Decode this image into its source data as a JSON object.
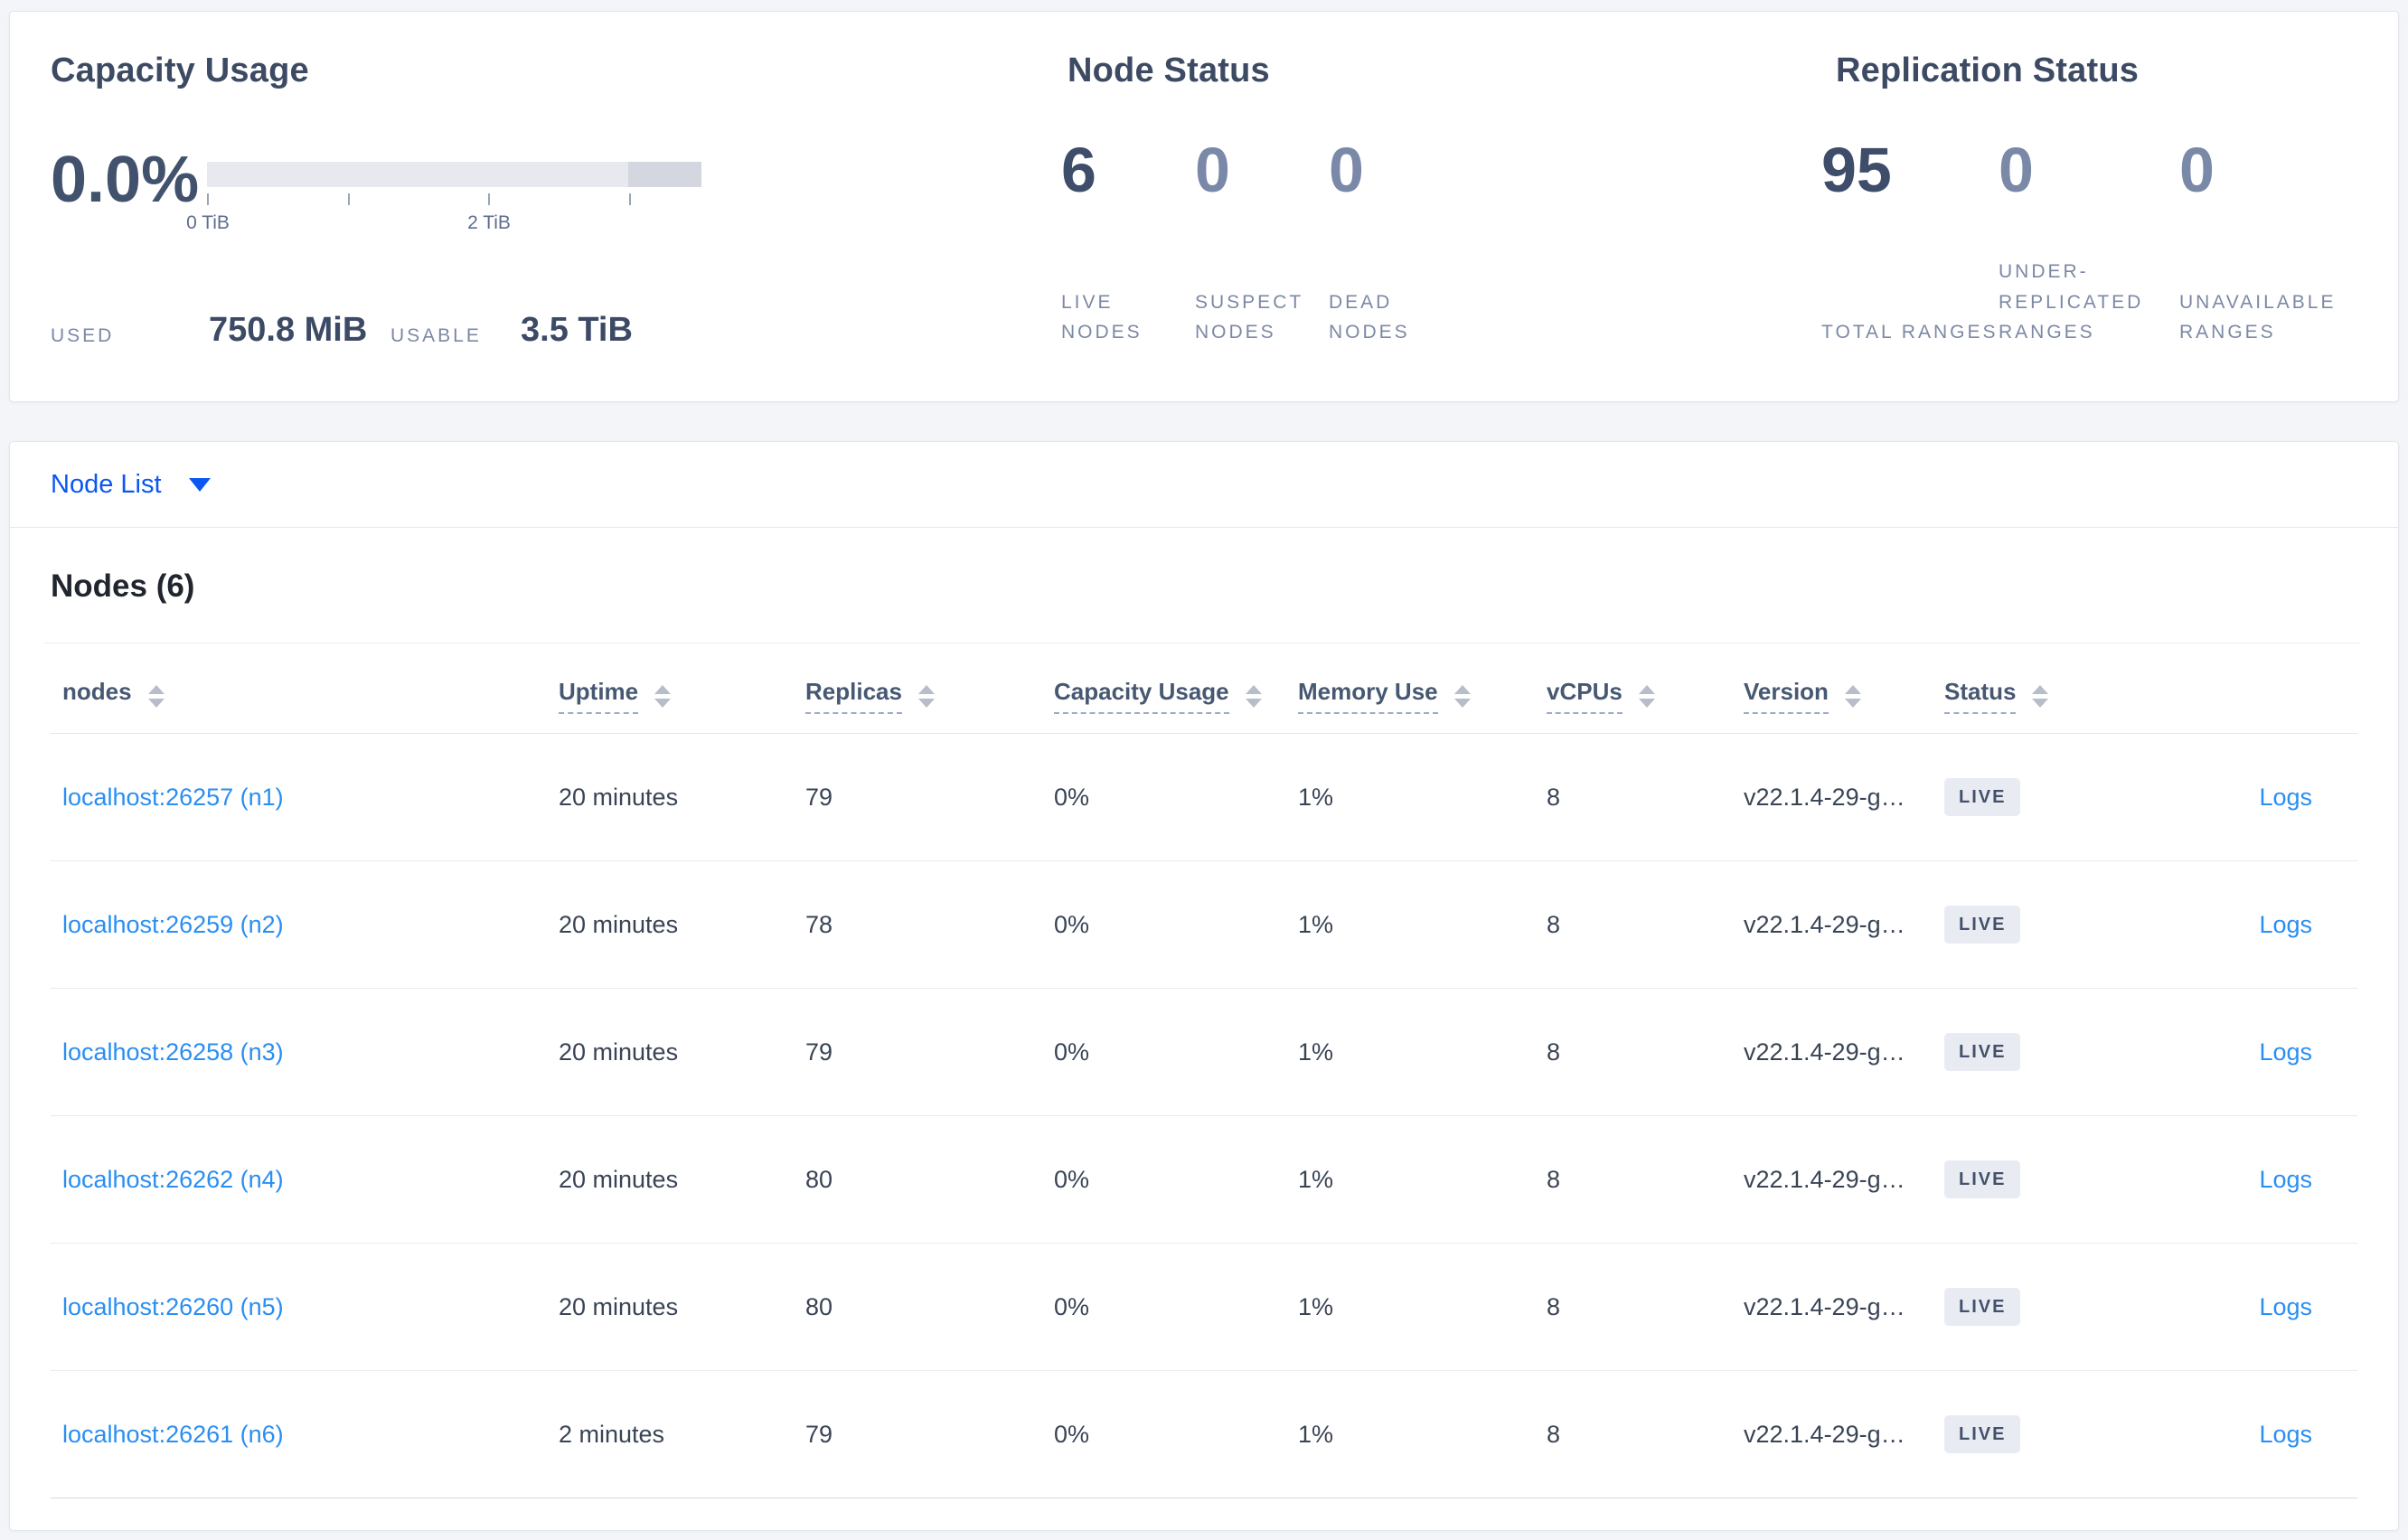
{
  "colors": {
    "accent_blue": "#0a57f2",
    "link_blue": "#2a8ef2",
    "dark_slate": "#394455",
    "muted_slate": "#7c89a4",
    "badge_bg": "#e8ebf2",
    "bar_track": "#e8e9ef",
    "bar_tail": "#d4d7e0"
  },
  "summary": {
    "capacity": {
      "title": "Capacity Usage",
      "percent": "0.0%",
      "axis": {
        "ticks": [
          {
            "pos": 0,
            "label": "0 TiB"
          },
          {
            "pos": 0.2843,
            "label": ""
          },
          {
            "pos": 0.5686,
            "label": "2 TiB"
          },
          {
            "pos": 0.8529,
            "label": ""
          }
        ]
      },
      "used_label": "USED",
      "used_value": "750.8 MiB",
      "usable_label": "USABLE",
      "usable_value": "3.5 TiB"
    },
    "node_status": {
      "title": "Node Status",
      "stats": [
        {
          "value": "6",
          "label": "LIVE NODES",
          "emphasis": true
        },
        {
          "value": "0",
          "label": "SUSPECT NODES",
          "emphasis": false
        },
        {
          "value": "0",
          "label": "DEAD NODES",
          "emphasis": false
        }
      ]
    },
    "replication": {
      "title": "Replication Status",
      "stats": [
        {
          "value": "95",
          "label": "TOTAL RANGES",
          "emphasis": true
        },
        {
          "value": "0",
          "label": "UNDER-REPLICATED RANGES",
          "emphasis": false
        },
        {
          "value": "0",
          "label": "UNAVAILABLE RANGES",
          "emphasis": false
        }
      ]
    }
  },
  "view_selector": {
    "label": "Node List"
  },
  "nodes_section": {
    "title": "Nodes (6)",
    "columns": [
      {
        "label": "nodes",
        "dashed": false
      },
      {
        "label": "Uptime",
        "dashed": true
      },
      {
        "label": "Replicas",
        "dashed": true
      },
      {
        "label": "Capacity Usage",
        "dashed": true
      },
      {
        "label": "Memory Use",
        "dashed": true
      },
      {
        "label": "vCPUs",
        "dashed": true
      },
      {
        "label": "Version",
        "dashed": true
      },
      {
        "label": "Status",
        "dashed": true
      },
      {
        "label": "",
        "dashed": false
      }
    ],
    "rows": [
      {
        "node": "localhost:26257 (n1)",
        "uptime": "20 minutes",
        "replicas": "79",
        "capacity": "0%",
        "memory": "1%",
        "vcpus": "8",
        "version": "v22.1.4-29-g…",
        "status": "LIVE",
        "logs": "Logs"
      },
      {
        "node": "localhost:26259 (n2)",
        "uptime": "20 minutes",
        "replicas": "78",
        "capacity": "0%",
        "memory": "1%",
        "vcpus": "8",
        "version": "v22.1.4-29-g…",
        "status": "LIVE",
        "logs": "Logs"
      },
      {
        "node": "localhost:26258 (n3)",
        "uptime": "20 minutes",
        "replicas": "79",
        "capacity": "0%",
        "memory": "1%",
        "vcpus": "8",
        "version": "v22.1.4-29-g…",
        "status": "LIVE",
        "logs": "Logs"
      },
      {
        "node": "localhost:26262 (n4)",
        "uptime": "20 minutes",
        "replicas": "80",
        "capacity": "0%",
        "memory": "1%",
        "vcpus": "8",
        "version": "v22.1.4-29-g…",
        "status": "LIVE",
        "logs": "Logs"
      },
      {
        "node": "localhost:26260 (n5)",
        "uptime": "20 minutes",
        "replicas": "80",
        "capacity": "0%",
        "memory": "1%",
        "vcpus": "8",
        "version": "v22.1.4-29-g…",
        "status": "LIVE",
        "logs": "Logs"
      },
      {
        "node": "localhost:26261 (n6)",
        "uptime": "2 minutes",
        "replicas": "79",
        "capacity": "0%",
        "memory": "1%",
        "vcpus": "8",
        "version": "v22.1.4-29-g…",
        "status": "LIVE",
        "logs": "Logs"
      }
    ]
  }
}
